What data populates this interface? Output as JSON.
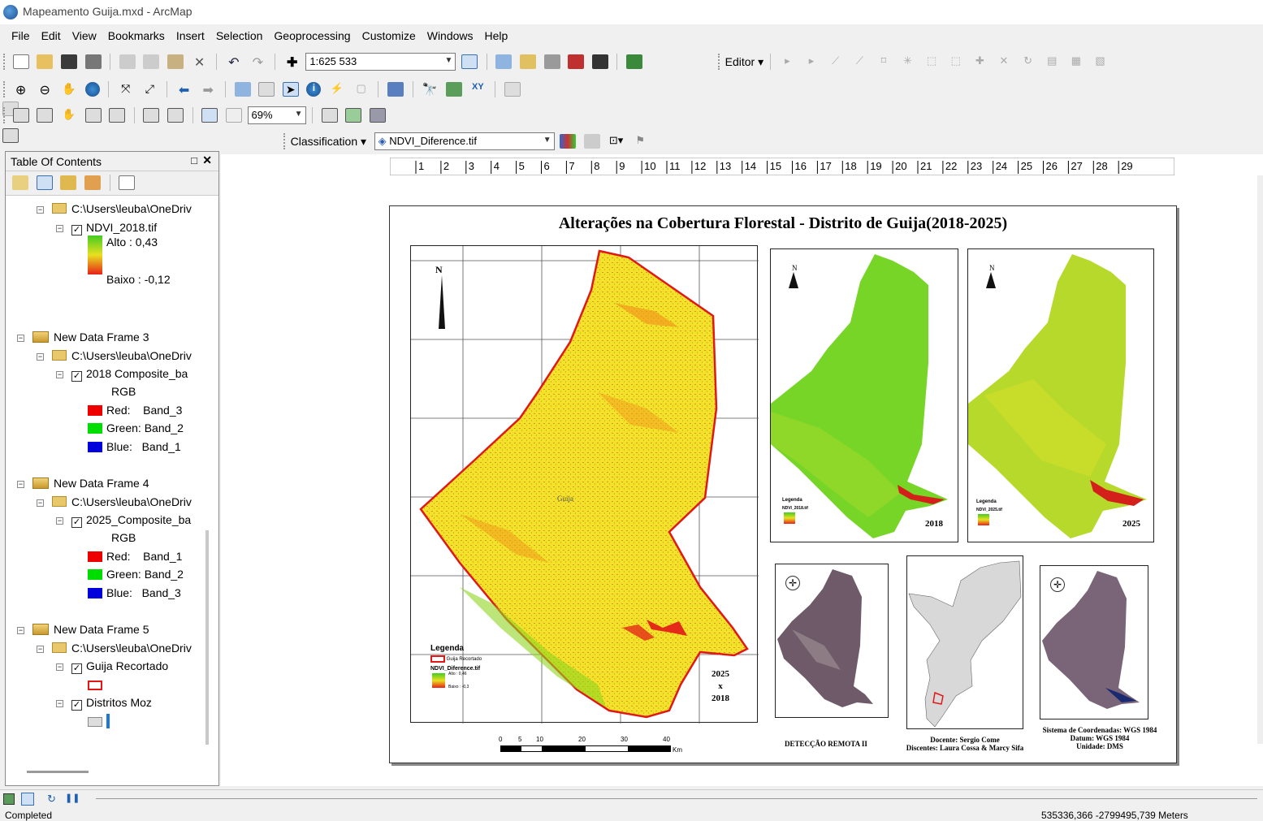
{
  "window": {
    "title": "Mapeamento Guija.mxd - ArcMap"
  },
  "menu": [
    "File",
    "Edit",
    "View",
    "Bookmarks",
    "Insert",
    "Selection",
    "Geoprocessing",
    "Customize",
    "Windows",
    "Help"
  ],
  "toolbar": {
    "scale": "1:625 533",
    "zoom": "69%",
    "editor": "Editor",
    "classification": "Classification",
    "layer": "NDVI_Diference.tif"
  },
  "toc": {
    "title": "Table Of Contents",
    "path": "C:\\Users\\leuba\\OneDriv",
    "ndvi_layer": "NDVI_2018.tif",
    "alto": "Alto : 0,43",
    "baixo": "Baixo : -0,12",
    "frame3": "New Data Frame 3",
    "comp2018": "2018 Composite_ba",
    "rgb": "RGB",
    "f3_red": "Red:    Band_3",
    "f3_green": "Green: Band_2",
    "f3_blue": "Blue:   Band_1",
    "frame4": "New Data Frame 4",
    "comp2025": "2025_Composite_ba",
    "f4_red": "Red:    Band_1",
    "f4_green": "Green: Band_2",
    "f4_blue": "Blue:   Band_3",
    "frame5": "New Data Frame 5",
    "guija": "Guija Recortado",
    "distritos": "Distritos Moz"
  },
  "ruler_ticks": [
    "1",
    "2",
    "3",
    "4",
    "5",
    "6",
    "7",
    "8",
    "9",
    "10",
    "11",
    "12",
    "13",
    "14",
    "15",
    "16",
    "17",
    "18",
    "19",
    "20",
    "21",
    "22",
    "23",
    "24",
    "25",
    "26",
    "27",
    "28",
    "29"
  ],
  "layout": {
    "title": "Alterações na Cobertura Florestal - Distrito de Guija(2018-2025)",
    "north": "N",
    "place": "Guija",
    "legend": "Legenda",
    "leg_guija": "Guija Recortado",
    "leg_ndvi": "NDVI_Diference.tif",
    "leg_alto": "Alto : 0,46",
    "leg_baixo": "Baixo : -0,3",
    "compare": [
      "2025",
      "x",
      "2018"
    ],
    "year2018": "2018",
    "year2025": "2025",
    "leg18": "NDVI_2018.tif",
    "leg25": "NDVI_2025.tif",
    "leg_small": "Legenda",
    "scale_ticks": [
      "0",
      "5",
      "10",
      "20",
      "30",
      "40"
    ],
    "km": "Km",
    "course": "DETECÇÃO REMOTA II",
    "docente": "Docente: Sergio Come",
    "discentes": "Discentes: Laura Cossa & Marcy Sifa",
    "crs": "Sistema de  Coordenadas: WGS 1984",
    "datum": "Datum: WGS 1984",
    "unidade": "Unidade: DMS"
  },
  "colors": {
    "ndvi_high": "#4cd319",
    "ndvi_low": "#e8281b",
    "boundary": "#e01818"
  },
  "status": {
    "left": "Completed",
    "coords": "535336,366  -2799495,739 Meters"
  }
}
